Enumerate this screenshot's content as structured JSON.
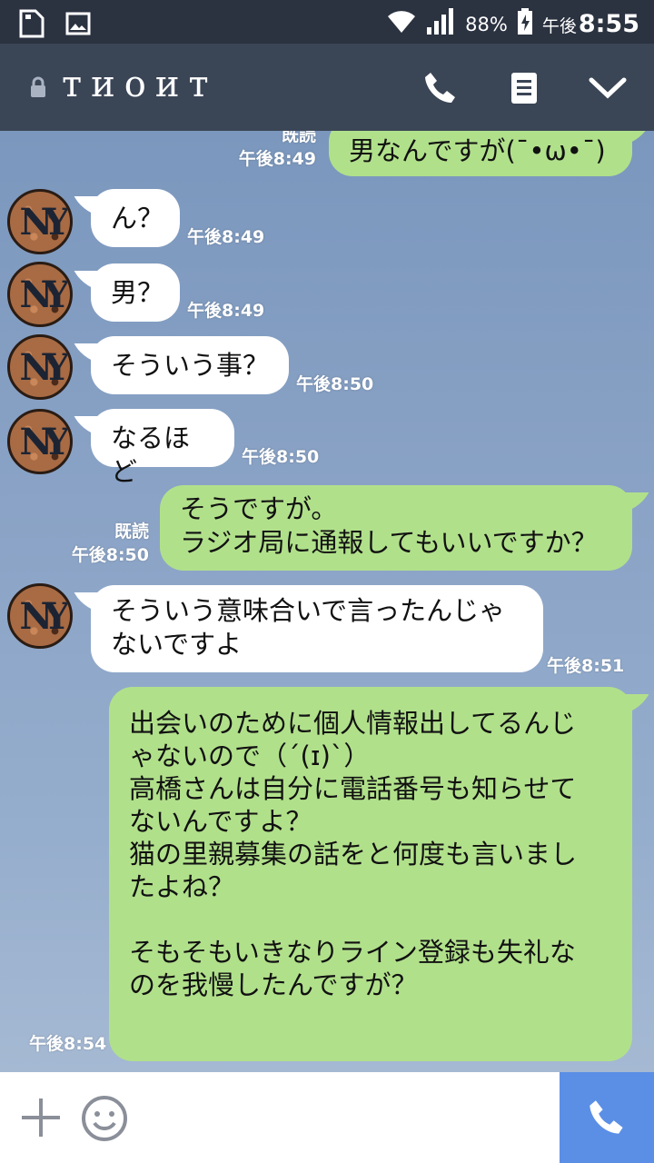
{
  "status_bar": {
    "battery": "88%",
    "time_prefix": "午後",
    "time": "8:55"
  },
  "header": {
    "title": "тиоит"
  },
  "messages": [
    {
      "side": "out",
      "text": "男なんですが(¯•ω•¯)",
      "read": "既読",
      "time": "午後8:49"
    },
    {
      "side": "in",
      "text": "ん？",
      "time": "午後8:49"
    },
    {
      "side": "in",
      "text": "男？",
      "time": "午後8:49"
    },
    {
      "side": "in",
      "text": "そういう事？",
      "time": "午後8:50"
    },
    {
      "side": "in",
      "text": "なるほど",
      "time": "午後8:50"
    },
    {
      "side": "out",
      "text": "そうですが。\nラジオ局に通報してもいいですか？",
      "read": "既読",
      "time": "午後8:50"
    },
    {
      "side": "in",
      "text": "そういう意味合いで言ったんじゃ\nないですよ",
      "time": "午後8:51"
    },
    {
      "side": "out",
      "text": "出会いのために個人情報出してるんじ\nゃないので（´(ɪ)`）\n高橋さんは自分に電話番号も知らせて\nないんですよ？\n猫の里親募集の話をと何度も言いまし\nたよね？\n\nそもそもいきなりライン登録も失礼な\nのを我慢したんですが？",
      "time": "午後8:54"
    }
  ],
  "colors": {
    "header": "#3a4556",
    "status_bar": "#2b3240",
    "out_bubble": "#b1e08b",
    "in_bubble": "#ffffff",
    "call_button": "#5b8fe6"
  }
}
